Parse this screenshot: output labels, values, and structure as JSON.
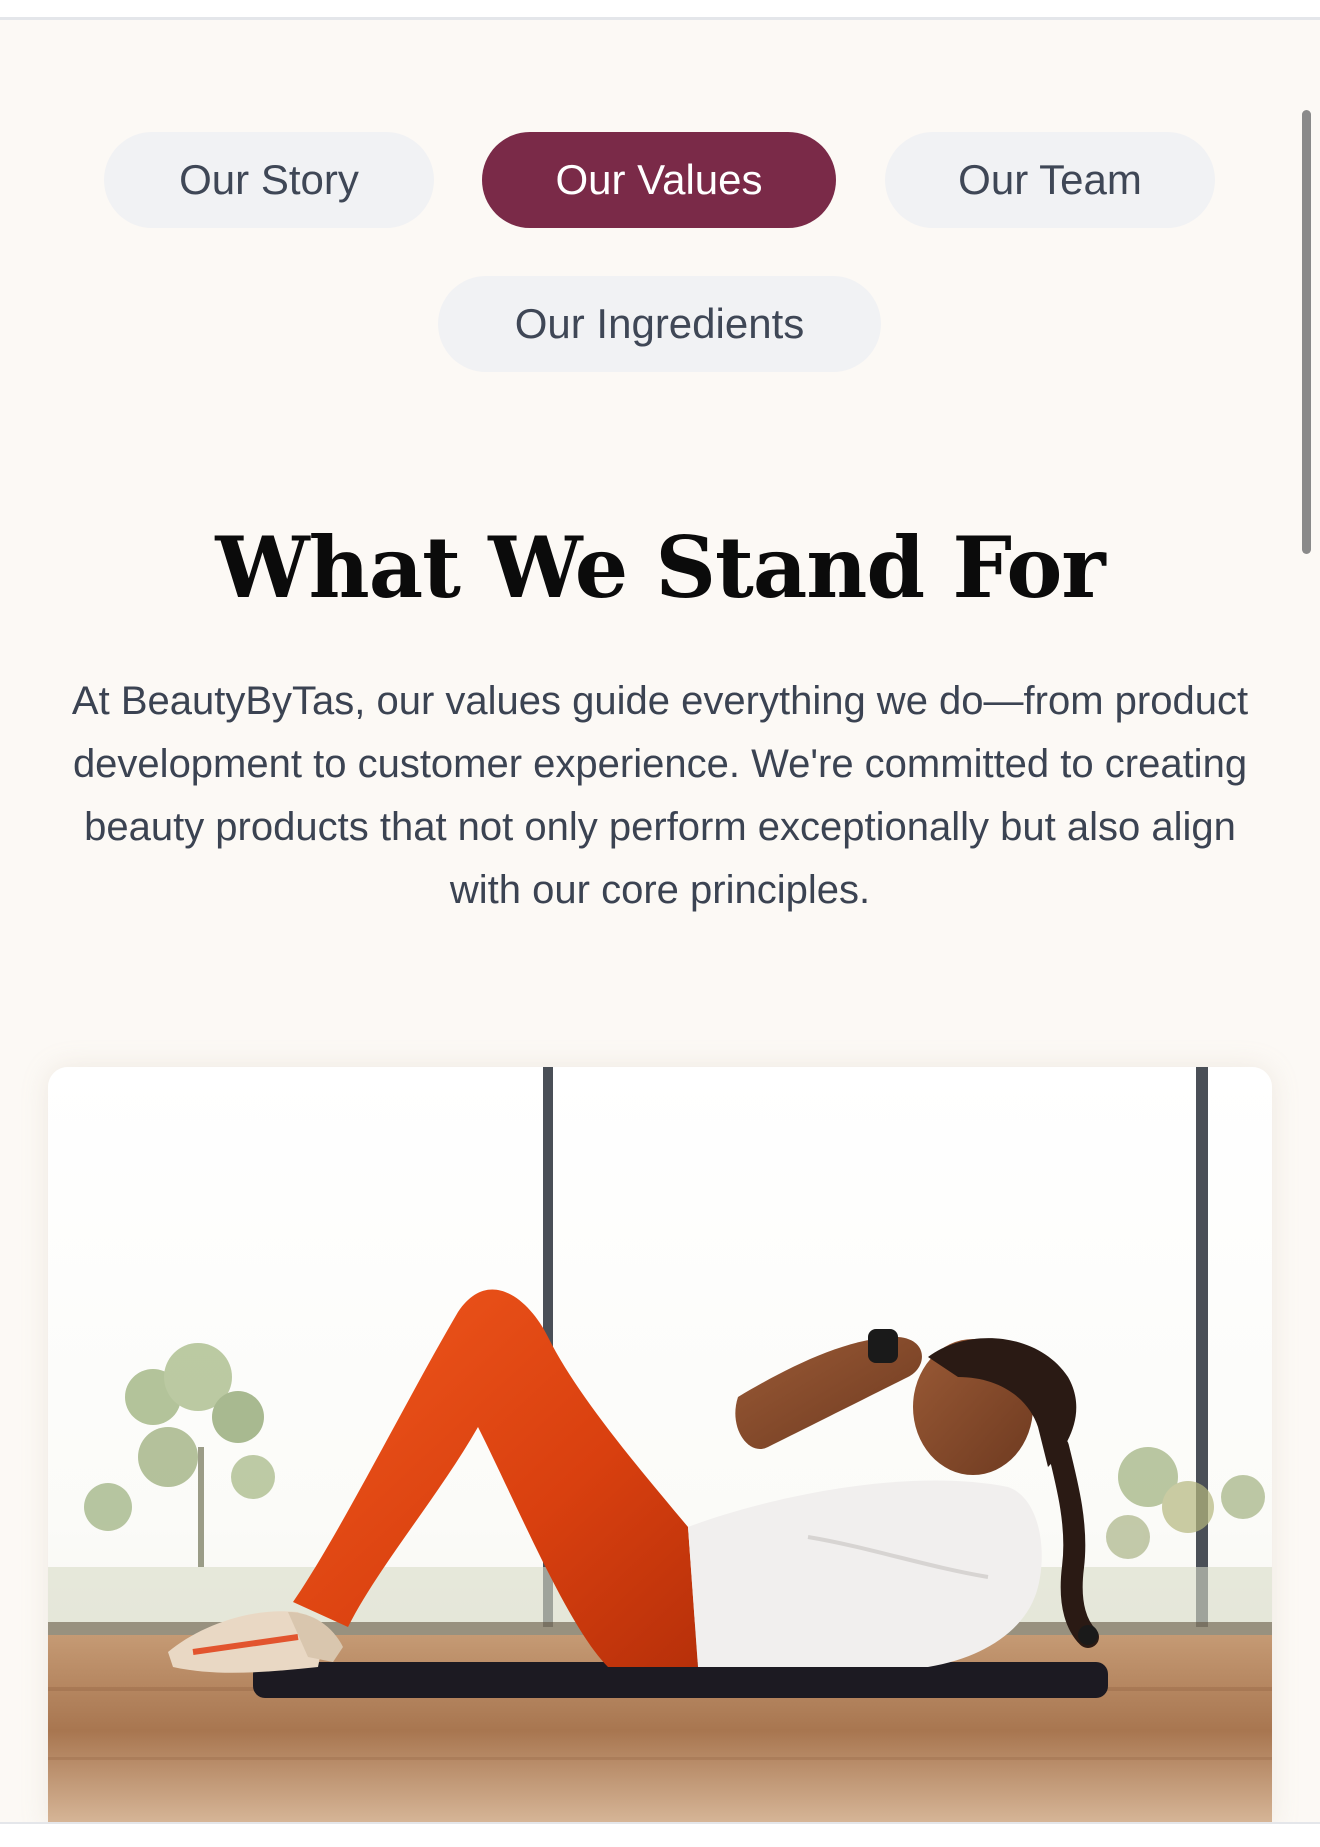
{
  "tabs": [
    {
      "label": "Our Story",
      "active": false
    },
    {
      "label": "Our Values",
      "active": true
    },
    {
      "label": "Our Team",
      "active": false
    },
    {
      "label": "Our Ingredients",
      "active": false
    }
  ],
  "section": {
    "heading": "What We Stand For",
    "intro": "At BeautyByTas, our values guide everything we do—from product development to customer experience. We're committed to creating beauty products that not only perform exceptionally but also align with our core principles."
  },
  "hero_image": {
    "subject": "woman doing crunches on an exercise mat in a bright room with floor-to-ceiling windows"
  },
  "colors": {
    "page_background": "#fcf9f5",
    "tab_active": "#7a2a48",
    "tab_inactive": "#f1f2f4",
    "tab_text": "#3f4756",
    "heading_text": "#0b0b0b",
    "body_text": "#3b4352"
  }
}
